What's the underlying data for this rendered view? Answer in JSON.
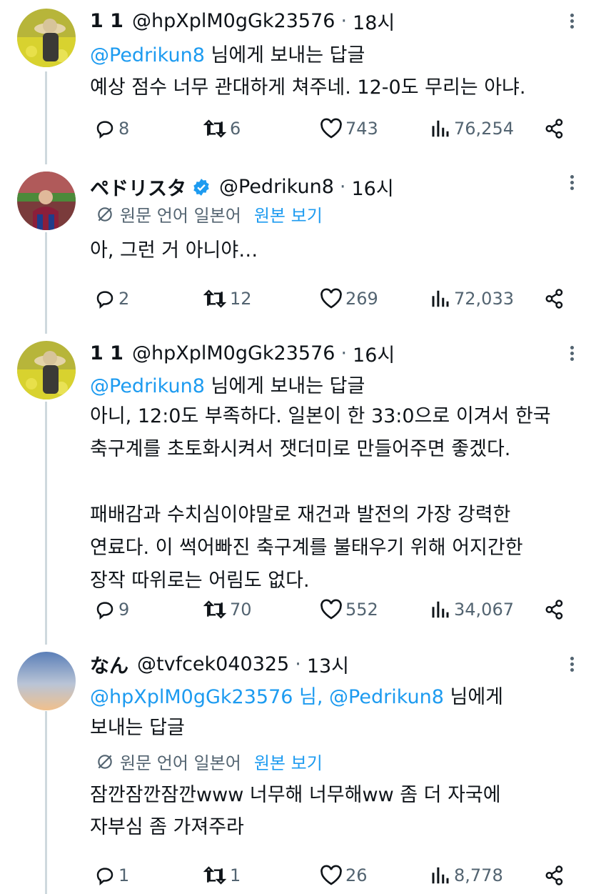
{
  "colors": {
    "accent": "#1d9bf0",
    "text": "#0f1419",
    "muted": "#536471",
    "line": "#cfd9de"
  },
  "tweets": [
    {
      "name": "1 1",
      "handle": "@hpXplM0gGk23576",
      "time": "18시",
      "reply_mention": "@Pedrikun8",
      "reply_suffix": " 님에게 보내는 답글",
      "body": "예상 점수 너무 관대하게 쳐주네. 12-0도 무리는 아냐.",
      "replies": "8",
      "retweets": "6",
      "likes": "743",
      "views": "76,254"
    },
    {
      "name": "ペドリスタ",
      "handle": "@Pedrikun8",
      "time": "16시",
      "translate_label": "원문 언어 일본어",
      "translate_link": "원본 보기",
      "body": "아, 그런 거 아니야…",
      "replies": "2",
      "retweets": "12",
      "likes": "269",
      "views": "72,033"
    },
    {
      "name": "1 1",
      "handle": "@hpXplM0gGk23576",
      "time": "16시",
      "reply_mention": "@Pedrikun8",
      "reply_suffix": " 님에게 보내는 답글",
      "body": "아니, 12:0도 부족하다. 일본이 한 33:0으로 이겨서 한국\n축구계를 초토화시켜서 잿더미로 만들어주면 좋겠다.\n\n패배감과 수치심이야말로 재건과 발전의 가장 강력한\n연료다. 이 썩어빠진 축구계를 불태우기 위해 어지간한\n장작 따위로는 어림도 없다.",
      "replies": "9",
      "retweets": "70",
      "likes": "552",
      "views": "34,067"
    },
    {
      "name": "なん",
      "handle": "@tvfcek040325",
      "time": "13시",
      "reply_mention1": "@hpXplM0gGk23576 님, @Pedrikun8",
      "reply_suffix1": " 님에게",
      "reply_line2": "보내는 답글",
      "translate_label": "원문 언어 일본어",
      "translate_link": "원본 보기",
      "body": "잠깐잠깐잠깐www 너무해 너무해ww 좀 더 자국에\n자부심 좀 가져주라",
      "replies": "1",
      "retweets": "1",
      "likes": "26",
      "views": "8,778"
    }
  ]
}
